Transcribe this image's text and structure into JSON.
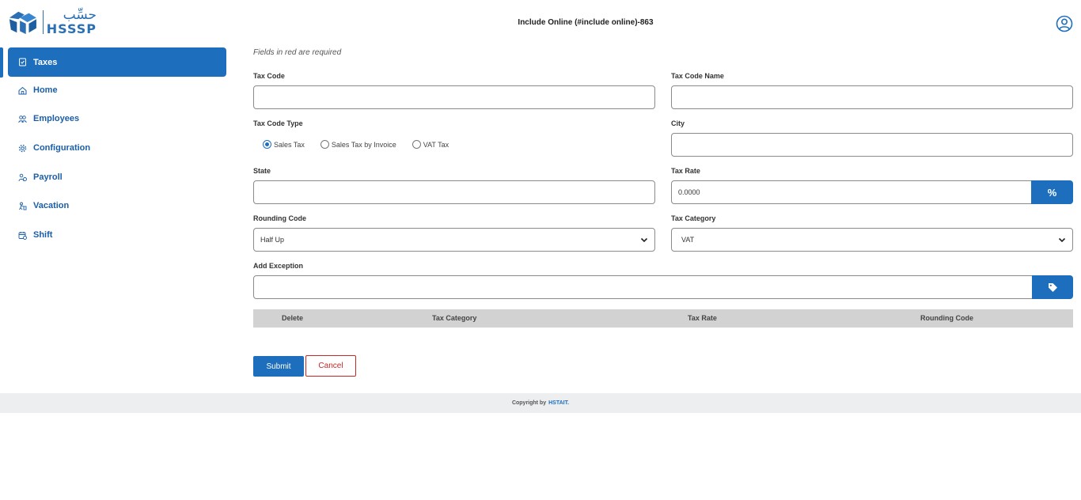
{
  "app": {
    "logo_arabic": "حسِّب",
    "logo_latin": "HSSSP",
    "page_title": "Include Online (#include online)-863"
  },
  "sidebar": {
    "items": [
      {
        "label": "Taxes",
        "icon": "clipboard-check-icon",
        "active": true
      },
      {
        "label": "Home",
        "icon": "home-icon"
      },
      {
        "label": "Employees",
        "icon": "users-icon"
      },
      {
        "label": "Configuration",
        "icon": "gear-icon"
      },
      {
        "label": "Payroll",
        "icon": "payroll-icon"
      },
      {
        "label": "Vacation",
        "icon": "vacation-icon"
      },
      {
        "label": "Shift",
        "icon": "shift-calendar-icon"
      }
    ]
  },
  "form": {
    "required_note": "Fields in red are required",
    "tax_code": {
      "label": "Tax Code",
      "value": ""
    },
    "tax_code_name": {
      "label": "Tax Code Name",
      "value": ""
    },
    "tax_code_type": {
      "label": "Tax Code Type",
      "options": [
        "Sales Tax",
        "Sales Tax by Invoice",
        "VAT Tax"
      ],
      "selected": "Sales Tax"
    },
    "city": {
      "label": "City",
      "value": ""
    },
    "state": {
      "label": "State",
      "value": ""
    },
    "tax_rate": {
      "label": "Tax Rate",
      "value": "0.0000",
      "addon": "%"
    },
    "rounding_code": {
      "label": "Rounding Code",
      "value": "Half Up"
    },
    "tax_category": {
      "label": "Tax Category",
      "value": "VAT"
    },
    "add_exception": {
      "label": "Add Exception",
      "value": ""
    }
  },
  "table": {
    "columns": [
      "Delete",
      "Tax Category",
      "Tax Rate",
      "Rounding Code"
    ]
  },
  "buttons": {
    "submit": "Submit",
    "cancel": "Cancel"
  },
  "footer": {
    "copyright": "Copyright by",
    "brand": "HSTAIT."
  },
  "colors": {
    "primary": "#1d6fbd",
    "danger": "#c62828",
    "table_header": "#d2d2d2",
    "footer_bg": "#eceeef"
  }
}
